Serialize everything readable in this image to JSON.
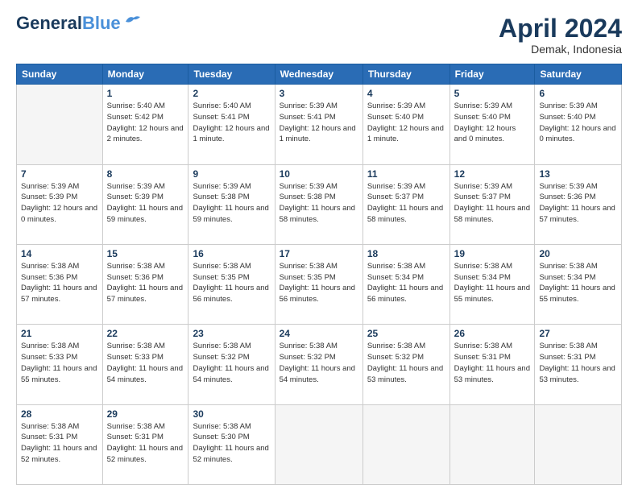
{
  "header": {
    "logo_line1": "General",
    "logo_line2": "Blue",
    "month_year": "April 2024",
    "location": "Demak, Indonesia"
  },
  "days_of_week": [
    "Sunday",
    "Monday",
    "Tuesday",
    "Wednesday",
    "Thursday",
    "Friday",
    "Saturday"
  ],
  "weeks": [
    [
      {
        "num": "",
        "info": ""
      },
      {
        "num": "1",
        "info": "Sunrise: 5:40 AM\nSunset: 5:42 PM\nDaylight: 12 hours\nand 2 minutes."
      },
      {
        "num": "2",
        "info": "Sunrise: 5:40 AM\nSunset: 5:41 PM\nDaylight: 12 hours\nand 1 minute."
      },
      {
        "num": "3",
        "info": "Sunrise: 5:39 AM\nSunset: 5:41 PM\nDaylight: 12 hours\nand 1 minute."
      },
      {
        "num": "4",
        "info": "Sunrise: 5:39 AM\nSunset: 5:40 PM\nDaylight: 12 hours\nand 1 minute."
      },
      {
        "num": "5",
        "info": "Sunrise: 5:39 AM\nSunset: 5:40 PM\nDaylight: 12 hours\nand 0 minutes."
      },
      {
        "num": "6",
        "info": "Sunrise: 5:39 AM\nSunset: 5:40 PM\nDaylight: 12 hours\nand 0 minutes."
      }
    ],
    [
      {
        "num": "7",
        "info": "Sunrise: 5:39 AM\nSunset: 5:39 PM\nDaylight: 12 hours\nand 0 minutes."
      },
      {
        "num": "8",
        "info": "Sunrise: 5:39 AM\nSunset: 5:39 PM\nDaylight: 11 hours\nand 59 minutes."
      },
      {
        "num": "9",
        "info": "Sunrise: 5:39 AM\nSunset: 5:38 PM\nDaylight: 11 hours\nand 59 minutes."
      },
      {
        "num": "10",
        "info": "Sunrise: 5:39 AM\nSunset: 5:38 PM\nDaylight: 11 hours\nand 58 minutes."
      },
      {
        "num": "11",
        "info": "Sunrise: 5:39 AM\nSunset: 5:37 PM\nDaylight: 11 hours\nand 58 minutes."
      },
      {
        "num": "12",
        "info": "Sunrise: 5:39 AM\nSunset: 5:37 PM\nDaylight: 11 hours\nand 58 minutes."
      },
      {
        "num": "13",
        "info": "Sunrise: 5:39 AM\nSunset: 5:36 PM\nDaylight: 11 hours\nand 57 minutes."
      }
    ],
    [
      {
        "num": "14",
        "info": "Sunrise: 5:38 AM\nSunset: 5:36 PM\nDaylight: 11 hours\nand 57 minutes."
      },
      {
        "num": "15",
        "info": "Sunrise: 5:38 AM\nSunset: 5:36 PM\nDaylight: 11 hours\nand 57 minutes."
      },
      {
        "num": "16",
        "info": "Sunrise: 5:38 AM\nSunset: 5:35 PM\nDaylight: 11 hours\nand 56 minutes."
      },
      {
        "num": "17",
        "info": "Sunrise: 5:38 AM\nSunset: 5:35 PM\nDaylight: 11 hours\nand 56 minutes."
      },
      {
        "num": "18",
        "info": "Sunrise: 5:38 AM\nSunset: 5:34 PM\nDaylight: 11 hours\nand 56 minutes."
      },
      {
        "num": "19",
        "info": "Sunrise: 5:38 AM\nSunset: 5:34 PM\nDaylight: 11 hours\nand 55 minutes."
      },
      {
        "num": "20",
        "info": "Sunrise: 5:38 AM\nSunset: 5:34 PM\nDaylight: 11 hours\nand 55 minutes."
      }
    ],
    [
      {
        "num": "21",
        "info": "Sunrise: 5:38 AM\nSunset: 5:33 PM\nDaylight: 11 hours\nand 55 minutes."
      },
      {
        "num": "22",
        "info": "Sunrise: 5:38 AM\nSunset: 5:33 PM\nDaylight: 11 hours\nand 54 minutes."
      },
      {
        "num": "23",
        "info": "Sunrise: 5:38 AM\nSunset: 5:32 PM\nDaylight: 11 hours\nand 54 minutes."
      },
      {
        "num": "24",
        "info": "Sunrise: 5:38 AM\nSunset: 5:32 PM\nDaylight: 11 hours\nand 54 minutes."
      },
      {
        "num": "25",
        "info": "Sunrise: 5:38 AM\nSunset: 5:32 PM\nDaylight: 11 hours\nand 53 minutes."
      },
      {
        "num": "26",
        "info": "Sunrise: 5:38 AM\nSunset: 5:31 PM\nDaylight: 11 hours\nand 53 minutes."
      },
      {
        "num": "27",
        "info": "Sunrise: 5:38 AM\nSunset: 5:31 PM\nDaylight: 11 hours\nand 53 minutes."
      }
    ],
    [
      {
        "num": "28",
        "info": "Sunrise: 5:38 AM\nSunset: 5:31 PM\nDaylight: 11 hours\nand 52 minutes."
      },
      {
        "num": "29",
        "info": "Sunrise: 5:38 AM\nSunset: 5:31 PM\nDaylight: 11 hours\nand 52 minutes."
      },
      {
        "num": "30",
        "info": "Sunrise: 5:38 AM\nSunset: 5:30 PM\nDaylight: 11 hours\nand 52 minutes."
      },
      {
        "num": "",
        "info": ""
      },
      {
        "num": "",
        "info": ""
      },
      {
        "num": "",
        "info": ""
      },
      {
        "num": "",
        "info": ""
      }
    ]
  ]
}
